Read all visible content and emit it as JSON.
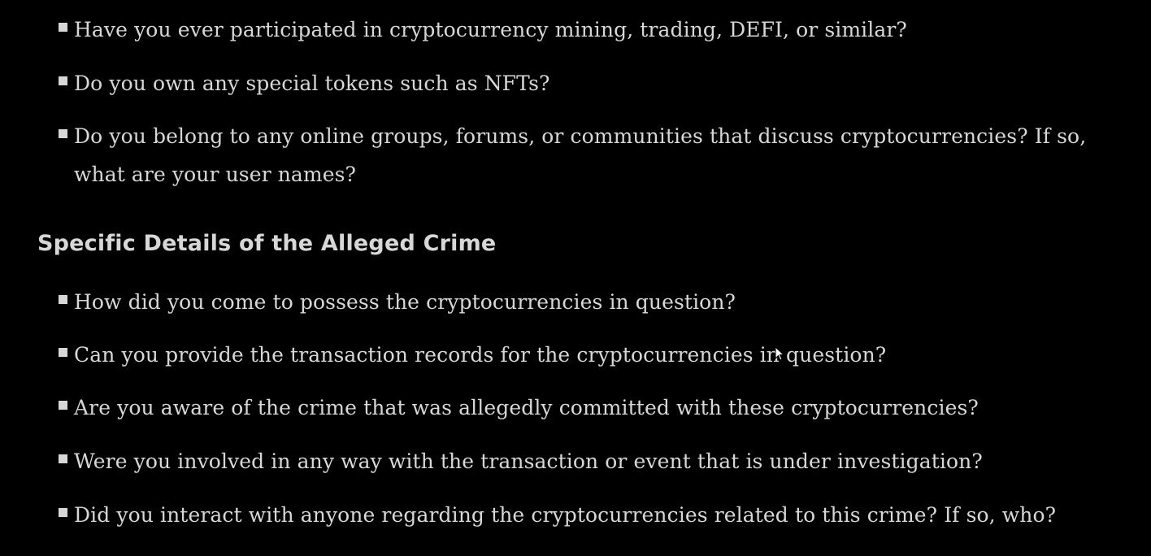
{
  "section_prior": {
    "items": [
      "Have you ever participated in cryptocurrency mining, trading, DEFI, or similar?",
      "Do you own any special tokens such as NFTs?",
      "Do you belong to any online groups, forums, or communities that discuss cryptocurrencies? If so, what are your user names?"
    ]
  },
  "section_crime": {
    "title": "Specific Details of the Alleged Crime",
    "items": [
      "How did you come to possess the cryptocurrencies in question?",
      "Can you provide the transaction records for the cryptocurrencies in question?",
      "Are you aware of the crime that was allegedly committed with these cryptocurrencies?",
      "Were you involved in any way with the transaction or event that is under investigation?",
      "Did you interact with anyone regarding the cryptocurrencies related to this crime? If so, who?"
    ]
  },
  "colors": {
    "background": "#000000",
    "text": "#d7d7d7"
  },
  "icons": {
    "bullet": "square-bullet-icon",
    "cursor": "mouse-pointer-icon"
  }
}
